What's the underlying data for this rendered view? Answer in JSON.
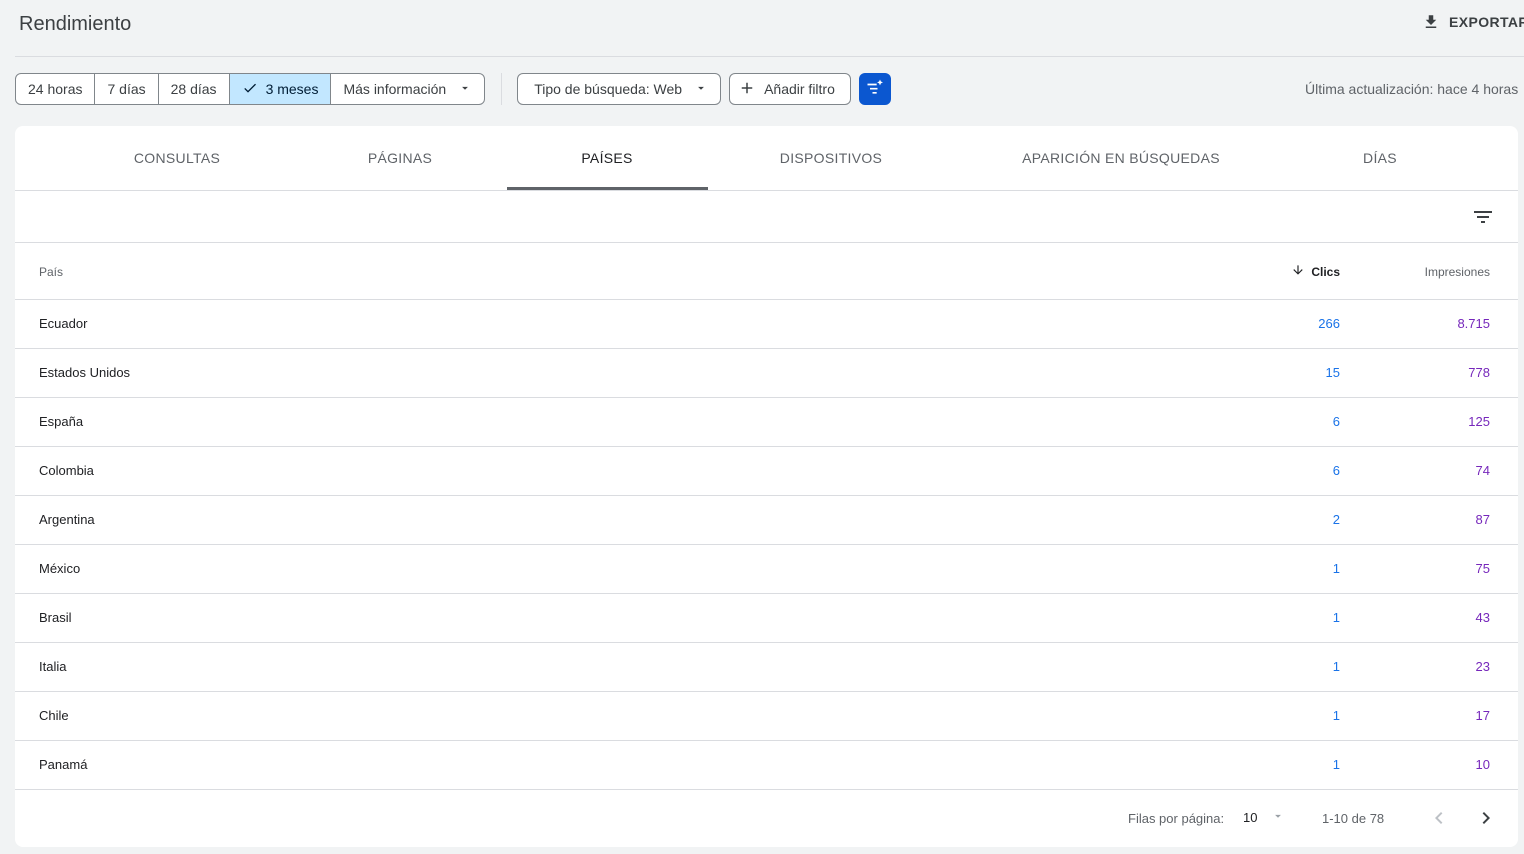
{
  "header": {
    "title": "Rendimiento",
    "export_label": "EXPORTAR",
    "export_icon": "download-icon"
  },
  "filters": {
    "date_ranges": [
      {
        "label": "24 horas",
        "selected": false
      },
      {
        "label": "7 días",
        "selected": false
      },
      {
        "label": "28 días",
        "selected": false
      },
      {
        "label": "3 meses",
        "selected": true
      },
      {
        "label": "Más información",
        "selected": false,
        "dropdown": true
      }
    ],
    "search_type_label": "Tipo de búsqueda: Web",
    "add_filter_label": "Añadir filtro",
    "last_update": "Última actualización: hace 4 horas",
    "accent_color": "#0b57d0",
    "selected_color": "#c2e7ff"
  },
  "tabs": [
    {
      "label": "CONSULTAS",
      "active": false
    },
    {
      "label": "PÁGINAS",
      "active": false
    },
    {
      "label": "PAÍSES",
      "active": true
    },
    {
      "label": "DISPOSITIVOS",
      "active": false
    },
    {
      "label": "APARICIÓN EN BÚSQUEDAS",
      "active": false
    },
    {
      "label": "DÍAS",
      "active": false
    }
  ],
  "table": {
    "columns": {
      "country": "País",
      "clicks": "Clics",
      "impressions": "Impresiones"
    },
    "sort": {
      "column": "clicks",
      "direction": "desc"
    },
    "rows": [
      {
        "country": "Ecuador",
        "clicks": "266",
        "impressions": "8.715"
      },
      {
        "country": "Estados Unidos",
        "clicks": "15",
        "impressions": "778"
      },
      {
        "country": "España",
        "clicks": "6",
        "impressions": "125"
      },
      {
        "country": "Colombia",
        "clicks": "6",
        "impressions": "74"
      },
      {
        "country": "Argentina",
        "clicks": "2",
        "impressions": "87"
      },
      {
        "country": "México",
        "clicks": "1",
        "impressions": "75"
      },
      {
        "country": "Brasil",
        "clicks": "1",
        "impressions": "43"
      },
      {
        "country": "Italia",
        "clicks": "1",
        "impressions": "23"
      },
      {
        "country": "Chile",
        "clicks": "1",
        "impressions": "17"
      },
      {
        "country": "Panamá",
        "clicks": "1",
        "impressions": "10"
      }
    ],
    "clicks_color": "#1a73e8",
    "impressions_color": "#7627bb"
  },
  "pagination": {
    "rows_per_page_label": "Filas por página:",
    "rows_per_page": "10",
    "range": "1-10 de 78"
  }
}
